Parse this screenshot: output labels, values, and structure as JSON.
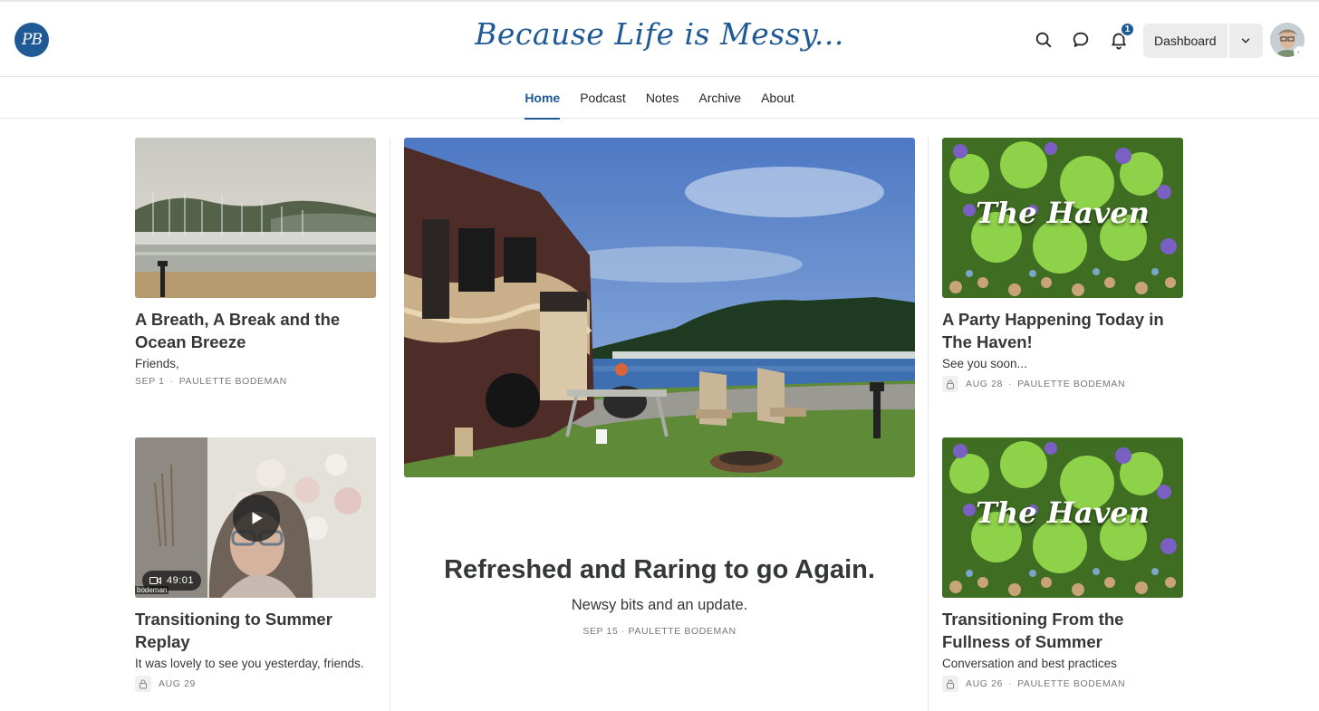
{
  "header": {
    "logo_text": "PB",
    "site_title": "Because Life is Messy...",
    "notification_count": "1",
    "dashboard_label": "Dashboard",
    "icons": [
      "search-icon",
      "chat-icon",
      "bell-icon",
      "chevron-down-icon"
    ]
  },
  "nav": {
    "tabs": [
      {
        "label": "Home",
        "active": true
      },
      {
        "label": "Podcast",
        "active": false
      },
      {
        "label": "Notes",
        "active": false
      },
      {
        "label": "Archive",
        "active": false
      },
      {
        "label": "About",
        "active": false
      }
    ]
  },
  "colors": {
    "accent": "#1f5a96",
    "text": "#363737",
    "meta": "#777777"
  },
  "featured": {
    "title": "Refreshed and Raring to go Again.",
    "subtitle": "Newsy bits and an update.",
    "date": "SEP 15",
    "author": "PAULETTE BODEMAN"
  },
  "left_posts": [
    {
      "title": "A Breath, A Break and the Ocean Breeze",
      "subtitle": "Friends,",
      "date": "SEP 1",
      "author": "PAULETTE BODEMAN",
      "locked": false
    },
    {
      "title": "Transitioning to Summer Replay",
      "subtitle": "It was lovely to see you yesterday, friends.",
      "date": "AUG 29",
      "author": "",
      "locked": true,
      "video_duration": "49:01",
      "video_caption": "bodeman"
    }
  ],
  "right_posts": [
    {
      "title": "A Party Happening Today in The Haven!",
      "subtitle": "See you soon...",
      "date": "AUG 28",
      "author": "PAULETTE BODEMAN",
      "locked": true,
      "image_text": "The Haven"
    },
    {
      "title": "Transitioning From the Fullness of Summer",
      "subtitle": "Conversation and best practices",
      "date": "AUG 26",
      "author": "PAULETTE BODEMAN",
      "locked": true,
      "image_text": "The Haven"
    }
  ]
}
